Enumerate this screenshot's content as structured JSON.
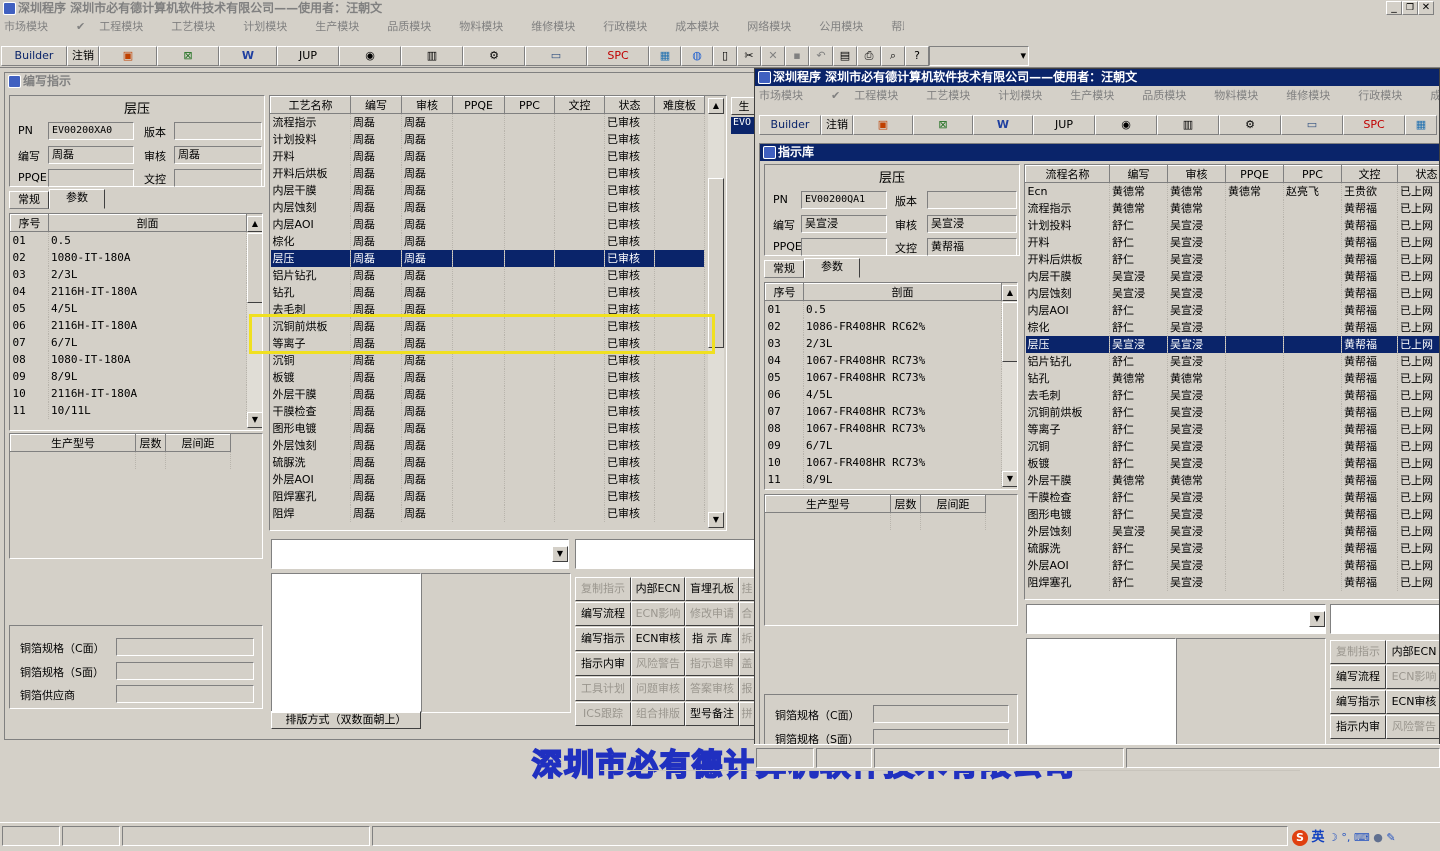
{
  "main": {
    "title": "深圳程序  深圳市必有德计算机软件技术有限公司——使用者：汪朝文",
    "menu": [
      {
        "label": "市场模块",
        "on": false
      },
      {
        "label": "工程模块",
        "on": true
      },
      {
        "label": "工艺模块",
        "on": false
      },
      {
        "label": "计划模块",
        "on": false
      },
      {
        "label": "生产模块",
        "on": false
      },
      {
        "label": "品质模块",
        "on": false
      },
      {
        "label": "物料模块",
        "on": false
      },
      {
        "label": "维修模块",
        "on": false
      },
      {
        "label": "行政模块",
        "on": false
      },
      {
        "label": "成本模块",
        "on": false
      },
      {
        "label": "网络模块",
        "on": false
      },
      {
        "label": "公用模块",
        "on": false
      },
      {
        "label": "帮助",
        "on": false
      }
    ],
    "toolbar": {
      "builder": "Builder",
      "logout": "注销",
      "jup": "JUP",
      "spc": "SPC"
    }
  },
  "left": {
    "title": "编写指示",
    "section": "层压",
    "pn_label": "PN",
    "pn_value": "EV00200XA0",
    "ver_label": "版本",
    "ver_value": "",
    "writer_label": "编写",
    "writer_value": "周磊",
    "audit_label": "审核",
    "audit_value": "周磊",
    "ppqe_label": "PPQE",
    "ppqe_value": "",
    "doc_label": "文控",
    "doc_value": "",
    "tabs": [
      "常规",
      "参数"
    ],
    "layers_head": [
      "序号",
      "剖面"
    ],
    "layers": [
      [
        "01",
        "0.5"
      ],
      [
        "02",
        "1080-IT-180A"
      ],
      [
        "03",
        "2/3L"
      ],
      [
        "04",
        "2116H-IT-180A"
      ],
      [
        "05",
        "4/5L"
      ],
      [
        "06",
        "2116H-IT-180A"
      ],
      [
        "07",
        "6/7L"
      ],
      [
        "08",
        "1080-IT-180A"
      ],
      [
        "09",
        "8/9L"
      ],
      [
        "10",
        "2116H-IT-180A"
      ],
      [
        "11",
        "10/11L"
      ]
    ],
    "model_head": [
      "生产型号",
      "层数",
      "层间距"
    ],
    "copper_c": "铜箔规格（C面）",
    "copper_s": "铜箔规格（S面）",
    "copper_supplier": "铜箔供应商",
    "proc_head": [
      "工艺名称",
      "编写",
      "审核",
      "PPQE",
      "PPC",
      "文控",
      "状态",
      "难度板"
    ],
    "procs": [
      [
        "流程指示",
        "周磊",
        "周磊",
        "",
        "",
        "",
        "已审核",
        ""
      ],
      [
        "计划投料",
        "周磊",
        "周磊",
        "",
        "",
        "",
        "已审核",
        ""
      ],
      [
        "开料",
        "周磊",
        "周磊",
        "",
        "",
        "",
        "已审核",
        ""
      ],
      [
        "开料后烘板",
        "周磊",
        "周磊",
        "",
        "",
        "",
        "已审核",
        ""
      ],
      [
        "内层干膜",
        "周磊",
        "周磊",
        "",
        "",
        "",
        "已审核",
        ""
      ],
      [
        "内层蚀刻",
        "周磊",
        "周磊",
        "",
        "",
        "",
        "已审核",
        ""
      ],
      [
        "内层AOI",
        "周磊",
        "周磊",
        "",
        "",
        "",
        "已审核",
        ""
      ],
      [
        "棕化",
        "周磊",
        "周磊",
        "",
        "",
        "",
        "已审核",
        ""
      ],
      [
        "层压",
        "周磊",
        "周磊",
        "",
        "",
        "",
        "已审核",
        ""
      ],
      [
        "铝片钻孔",
        "周磊",
        "周磊",
        "",
        "",
        "",
        "已审核",
        ""
      ],
      [
        "钻孔",
        "周磊",
        "周磊",
        "",
        "",
        "",
        "已审核",
        ""
      ],
      [
        "去毛刺",
        "周磊",
        "周磊",
        "",
        "",
        "",
        "已审核",
        ""
      ],
      [
        "沉铜前烘板",
        "周磊",
        "周磊",
        "",
        "",
        "",
        "已审核",
        ""
      ],
      [
        "等离子",
        "周磊",
        "周磊",
        "",
        "",
        "",
        "已审核",
        ""
      ],
      [
        "沉铜",
        "周磊",
        "周磊",
        "",
        "",
        "",
        "已审核",
        ""
      ],
      [
        "板镀",
        "周磊",
        "周磊",
        "",
        "",
        "",
        "已审核",
        ""
      ],
      [
        "外层干膜",
        "周磊",
        "周磊",
        "",
        "",
        "",
        "已审核",
        ""
      ],
      [
        "干膜检查",
        "周磊",
        "周磊",
        "",
        "",
        "",
        "已审核",
        ""
      ],
      [
        "图形电镀",
        "周磊",
        "周磊",
        "",
        "",
        "",
        "已审核",
        ""
      ],
      [
        "外层蚀刻",
        "周磊",
        "周磊",
        "",
        "",
        "",
        "已审核",
        ""
      ],
      [
        "硫脲洗",
        "周磊",
        "周磊",
        "",
        "",
        "",
        "已审核",
        ""
      ],
      [
        "外层AOI",
        "周磊",
        "周磊",
        "",
        "",
        "",
        "已审核",
        ""
      ],
      [
        "阻焊塞孔",
        "周磊",
        "周磊",
        "",
        "",
        "",
        "已审核",
        ""
      ],
      [
        "阻焊",
        "周磊",
        "周磊",
        "",
        "",
        "",
        "已审核",
        ""
      ]
    ],
    "side_col_head": "生",
    "side_col_value": "EVO",
    "sort_label": "排版方式（双数面朝上）",
    "buttons": [
      [
        {
          "t": "复制指示",
          "d": true
        },
        {
          "t": "内部ECN",
          "d": false
        },
        {
          "t": "盲埋孔板",
          "d": false
        },
        {
          "t": "挂",
          "d": true
        }
      ],
      [
        {
          "t": "编写流程",
          "d": false
        },
        {
          "t": "ECN影响",
          "d": true
        },
        {
          "t": "修改申请",
          "d": true
        },
        {
          "t": "合",
          "d": true
        }
      ],
      [
        {
          "t": "编写指示",
          "d": false
        },
        {
          "t": "ECN审核",
          "d": false
        },
        {
          "t": "指 示 库",
          "d": false
        },
        {
          "t": "拆",
          "d": true
        }
      ],
      [
        {
          "t": "指示内审",
          "d": false
        },
        {
          "t": "风险警告",
          "d": true
        },
        {
          "t": "指示退审",
          "d": true
        },
        {
          "t": "盖",
          "d": true
        }
      ],
      [
        {
          "t": "工具计划",
          "d": true
        },
        {
          "t": "问题审核",
          "d": true
        },
        {
          "t": "答案审核",
          "d": true
        },
        {
          "t": "报",
          "d": true
        }
      ],
      [
        {
          "t": "ICS跟踪",
          "d": true
        },
        {
          "t": "组合排版",
          "d": true
        },
        {
          "t": "型号备注",
          "d": false
        },
        {
          "t": "拼",
          "d": true
        }
      ]
    ]
  },
  "right": {
    "title": "深圳程序  深圳市必有德计算机软件技术有限公司——使用者：汪朝文",
    "menu": [
      {
        "label": "市场模块",
        "on": false
      },
      {
        "label": "工程模块",
        "on": true
      },
      {
        "label": "工艺模块",
        "on": false
      },
      {
        "label": "计划模块",
        "on": false
      },
      {
        "label": "生产模块",
        "on": true
      },
      {
        "label": "品质模块",
        "on": true
      },
      {
        "label": "物料模块",
        "on": false
      },
      {
        "label": "维修模块",
        "on": false
      },
      {
        "label": "行政模块",
        "on": false
      },
      {
        "label": "成本模块",
        "on": false
      },
      {
        "label": "网络模块",
        "on": true
      }
    ],
    "child_title": "指示库",
    "section": "层压",
    "pn_value": "EV00200QA1",
    "ver_value": "",
    "writer_value": "吴宣浸",
    "audit_value": "吴宣浸",
    "ppqe_value": "",
    "doc_value": "黄帮福",
    "layers": [
      [
        "01",
        "0.5"
      ],
      [
        "02",
        "1086-FR408HR RC62%"
      ],
      [
        "03",
        "2/3L"
      ],
      [
        "04",
        "1067-FR408HR RC73%"
      ],
      [
        "05",
        "1067-FR408HR RC73%"
      ],
      [
        "06",
        "4/5L"
      ],
      [
        "07",
        "1067-FR408HR RC73%"
      ],
      [
        "08",
        "1067-FR408HR RC73%"
      ],
      [
        "09",
        "6/7L"
      ],
      [
        "10",
        "1067-FR408HR RC73%"
      ],
      [
        "11",
        "8/9L"
      ]
    ],
    "proc_head": [
      "流程名称",
      "编写",
      "审核",
      "PPQE",
      "PPC",
      "文控",
      "状态"
    ],
    "procs": [
      [
        "Ecn",
        "黄德常",
        "黄德常",
        "黄德常",
        "赵亮飞",
        "王贵欲",
        "已上网"
      ],
      [
        "流程指示",
        "黄德常",
        "黄德常",
        "",
        "",
        "黄帮福",
        "已上网"
      ],
      [
        "计划投料",
        "舒仁",
        "吴宣浸",
        "",
        "",
        "黄帮福",
        "已上网"
      ],
      [
        "开料",
        "舒仁",
        "吴宣浸",
        "",
        "",
        "黄帮福",
        "已上网"
      ],
      [
        "开料后烘板",
        "舒仁",
        "吴宣浸",
        "",
        "",
        "黄帮福",
        "已上网"
      ],
      [
        "内层干膜",
        "吴宣浸",
        "吴宣浸",
        "",
        "",
        "黄帮福",
        "已上网"
      ],
      [
        "内层蚀刻",
        "吴宣浸",
        "吴宣浸",
        "",
        "",
        "黄帮福",
        "已上网"
      ],
      [
        "内层AOI",
        "舒仁",
        "吴宣浸",
        "",
        "",
        "黄帮福",
        "已上网"
      ],
      [
        "棕化",
        "舒仁",
        "吴宣浸",
        "",
        "",
        "黄帮福",
        "已上网"
      ],
      [
        "层压",
        "吴宣浸",
        "吴宣浸",
        "",
        "",
        "黄帮福",
        "已上网"
      ],
      [
        "铝片钻孔",
        "舒仁",
        "吴宣浸",
        "",
        "",
        "黄帮福",
        "已上网"
      ],
      [
        "钻孔",
        "黄德常",
        "黄德常",
        "",
        "",
        "黄帮福",
        "已上网"
      ],
      [
        "去毛刺",
        "舒仁",
        "吴宣浸",
        "",
        "",
        "黄帮福",
        "已上网"
      ],
      [
        "沉铜前烘板",
        "舒仁",
        "吴宣浸",
        "",
        "",
        "黄帮福",
        "已上网"
      ],
      [
        "等离子",
        "舒仁",
        "吴宣浸",
        "",
        "",
        "黄帮福",
        "已上网"
      ],
      [
        "沉铜",
        "舒仁",
        "吴宣浸",
        "",
        "",
        "黄帮福",
        "已上网"
      ],
      [
        "板镀",
        "舒仁",
        "吴宣浸",
        "",
        "",
        "黄帮福",
        "已上网"
      ],
      [
        "外层干膜",
        "黄德常",
        "黄德常",
        "",
        "",
        "黄帮福",
        "已上网"
      ],
      [
        "干膜检查",
        "舒仁",
        "吴宣浸",
        "",
        "",
        "黄帮福",
        "已上网"
      ],
      [
        "图形电镀",
        "舒仁",
        "吴宣浸",
        "",
        "",
        "黄帮福",
        "已上网"
      ],
      [
        "外层蚀刻",
        "吴宣浸",
        "吴宣浸",
        "",
        "",
        "黄帮福",
        "已上网"
      ],
      [
        "硫脲洗",
        "舒仁",
        "吴宣浸",
        "",
        "",
        "黄帮福",
        "已上网"
      ],
      [
        "外层AOI",
        "舒仁",
        "吴宣浸",
        "",
        "",
        "黄帮福",
        "已上网"
      ],
      [
        "阻焊塞孔",
        "舒仁",
        "吴宣浸",
        "",
        "",
        "黄帮福",
        "已上网"
      ]
    ],
    "buttons": [
      [
        {
          "t": "复制指示",
          "d": true
        },
        {
          "t": "内部ECN",
          "d": false
        }
      ],
      [
        {
          "t": "编写流程",
          "d": false
        },
        {
          "t": "ECN影响",
          "d": true
        }
      ],
      [
        {
          "t": "编写指示",
          "d": false
        },
        {
          "t": "ECN审核",
          "d": false
        }
      ],
      [
        {
          "t": "指示内审",
          "d": false
        },
        {
          "t": "风险警告",
          "d": true
        }
      ]
    ]
  },
  "watermark": "深圳市必有德计算机软件技术有限公司",
  "tray": {
    "ime": "英"
  }
}
